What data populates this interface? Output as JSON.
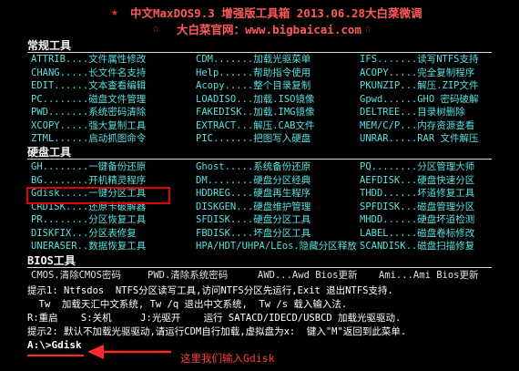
{
  "header": {
    "title": "中文MaxDOS9.3 增强版工具箱 2013.06.28大白菜微调",
    "subtitle": "大白菜官网：www.bigbaicai.com"
  },
  "sections": {
    "common": "常规工具",
    "disk": "硬盘工具",
    "bios": "BIOS工具"
  },
  "common_rows": [
    [
      "ATTRIB....文件属性修改",
      "CDM.......加载光驱菜单",
      "IFS.......读写NTFS支持"
    ],
    [
      "CHANG.....长文件名支持",
      "Help......帮助指令使用",
      "ACOPY.....完全复制程序"
    ],
    [
      "EDIT......文本查看编辑",
      "Acopy.....整个目录复制",
      "PKUNZIP...解压.ZIP文件"
    ],
    [
      "PC........磁盘文件管理",
      "LOADISO...加载.ISO镜像",
      "Gpwd......GHO 密码破解"
    ],
    [
      "PWD.......系统密码清除",
      "FAKEDISK..加载.IMG镜像",
      "DELTREE...目录树删除"
    ],
    [
      "XCOPY.....强大复制工具",
      "EXTRACT...解压.CAB文件",
      "MEM/C/P...内存资源查看"
    ],
    [
      "ZTML......启动抓图命令",
      "PIC.......把图写入硬盘",
      "UNRAR.....RAR 文件解压"
    ]
  ],
  "disk_rows": [
    [
      "GH........一键备份还原",
      "Ghost.....系统备份还原",
      "PQ........分区管理大师"
    ],
    [
      "BG........开机精灵程序",
      "DM........硬盘分区经典",
      "AEFDISK...硬盘快速分区"
    ],
    [
      "Gdisk.....一键分区工具",
      "HDDREG....硬盘再生程序",
      "THDD......坏道修复工具"
    ],
    [
      "CRDISK....还原卡破解器",
      "DISKGEN...硬盘维护管理",
      "SPFDISK...磁盘管理分区"
    ],
    [
      "PR........分区恢复工具",
      "SFDISK....硬盘分区工具",
      "MHDD......硬盘坏道检测"
    ],
    [
      "DISKFIX...分区表修复",
      "FBDISK....坏盘分区工具",
      "LABEL.....磁盘卷标修改"
    ],
    [
      "UNERASER..数据恢复工具",
      "HPA/HDT/UHPA/LEos.隐藏分区释放",
      "SCANDISK..磁盘扫描修复"
    ]
  ],
  "bios_row": [
    "CMOS.清除CMOS密码",
    "PWD.清除系统密码",
    "AWD...Awd Bios更新",
    "Ami...Ami Bios更新"
  ],
  "tips": {
    "tip1": "提示1: Ntfsdos  NTFS分区读写工具,访问NTFS分区先运行,Exit 退出NTFS支持.",
    "tip1b": "  Tw  加载天汇中文系统, Tw /q 退出中文系统,  Tw /s 载入输入法.",
    "keys": "R:重启    S:关机     J:光驱开    运行 SATACD/IDECD/USBCD 加载光驱驱动.",
    "tip2": "提示2: 默认不加载光驱驱动,请运行CDM自行加载,虚拟盘为x:  键入\"M\"返回到此菜单."
  },
  "prompt": "A:\\>Gdisk",
  "annotation": "这里我们输入Gdisk"
}
